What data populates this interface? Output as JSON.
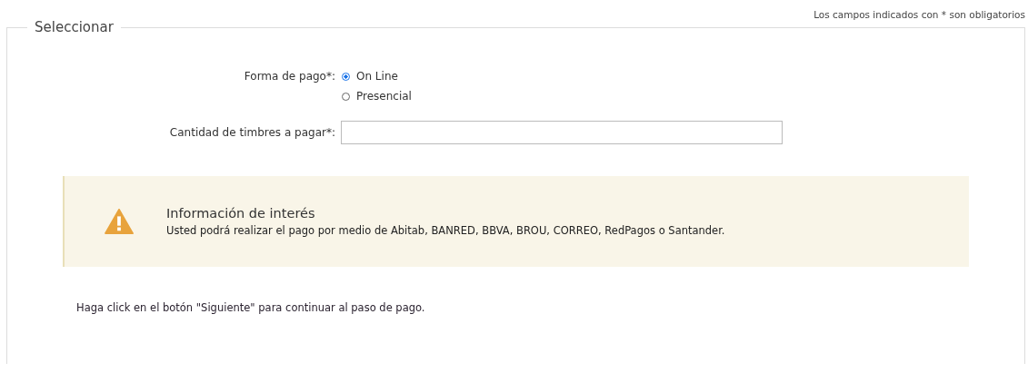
{
  "required_note": "Los campos indicados con * son obligatorios",
  "legend": "Seleccionar",
  "payment": {
    "label": "Forma de pago*:",
    "options": [
      {
        "label": "On Line",
        "selected": true
      },
      {
        "label": "Presencial",
        "selected": false
      }
    ]
  },
  "quantity": {
    "label": "Cantidad de timbres a pagar*:"
  },
  "info": {
    "title": "Información de interés",
    "text": "Usted podrá realizar el pago por medio de Abitab, BANRED, BBVA, BROU, CORREO, RedPagos o Santander."
  },
  "footer": "Haga click en el botón \"Siguiente\" para continuar al paso de pago."
}
